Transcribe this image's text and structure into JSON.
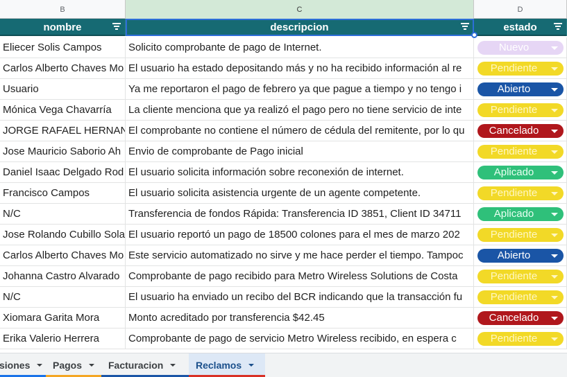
{
  "columns": [
    {
      "letter": "B",
      "header": "nombre",
      "selected": false
    },
    {
      "letter": "C",
      "header": "descripcion",
      "selected": true
    },
    {
      "letter": "D",
      "header": "estado",
      "selected": false
    }
  ],
  "status_colors": {
    "Nuevo": {
      "bg": "#e6d6f5",
      "fg": "#ffffff"
    },
    "Pendiente": {
      "bg": "#f2d927",
      "fg": "#fff7c2"
    },
    "Abierto": {
      "bg": "#1a55a6",
      "fg": "#ffffff"
    },
    "Cancelado": {
      "bg": "#b0171c",
      "fg": "#ffffff"
    },
    "Aplicado": {
      "bg": "#2fc07a",
      "fg": "#e9fff2"
    }
  },
  "rows": [
    {
      "nombre": "Eliecer Solis Campos",
      "descripcion": "Solicito comprobante de pago de Internet.",
      "estado": "Nuevo"
    },
    {
      "nombre": "Carlos Alberto Chaves Mo",
      "descripcion": "El usuario ha estado depositando más y no ha recibido información al re",
      "estado": "Pendiente"
    },
    {
      "nombre": "Usuario",
      "descripcion": "Ya me reportaron el pago de febrero ya que pague a tiempo y no tengo i",
      "estado": "Abierto"
    },
    {
      "nombre": "Mónica Vega Chavarría",
      "descripcion": "La cliente menciona que ya realizó el pago pero no tiene servicio de inte",
      "estado": "Pendiente"
    },
    {
      "nombre": "JORGE RAFAEL HERNAN",
      "descripcion": "El comprobante no contiene el número de cédula del remitente, por lo qu",
      "estado": "Cancelado"
    },
    {
      "nombre": "Jose Mauricio Saborio Ah",
      "descripcion": "Envio de comprobante de Pago inicial",
      "estado": "Pendiente"
    },
    {
      "nombre": "Daniel Isaac Delgado Rod",
      "descripcion": "El usuario solicita información sobre reconexión de internet.",
      "estado": "Aplicado"
    },
    {
      "nombre": "Francisco Campos",
      "descripcion": "El usuario solicita asistencia urgente de un agente competente.",
      "estado": "Pendiente"
    },
    {
      "nombre": "N/C",
      "descripcion": "Transferencia de fondos Rápida: Transferencia ID 3851, Client ID 34711",
      "estado": "Aplicado"
    },
    {
      "nombre": "Jose Rolando Cubillo Sola",
      "descripcion": "El usuario reportó un pago de 18500 colones para el mes de marzo 202",
      "estado": "Pendiente"
    },
    {
      "nombre": "Carlos Alberto Chaves Mo",
      "descripcion": "Este servicio automatizado no sirve y me hace perder el tiempo. Tampoc",
      "estado": "Abierto"
    },
    {
      "nombre": "Johanna Castro Alvarado",
      "descripcion": "Comprobante de pago recibido para Metro Wireless Solutions de Costa",
      "estado": "Pendiente"
    },
    {
      "nombre": "N/C",
      "descripcion": "El usuario ha enviado un recibo del BCR indicando que la transacción fu",
      "estado": "Pendiente"
    },
    {
      "nombre": "Xiomara Garita Mora",
      "descripcion": "Monto acreditado por transferencia $42.45",
      "estado": "Cancelado"
    },
    {
      "nombre": "Erika Valerio Herrera",
      "descripcion": "Comprobante de pago de servicio Metro Wireless recibido, en espera c",
      "estado": "Pendiente"
    }
  ],
  "tabs": [
    {
      "label": "siones",
      "active": false,
      "underline": "#1a73e8"
    },
    {
      "label": "Pagos",
      "active": false,
      "underline": "#f4a623"
    },
    {
      "label": "Facturacion",
      "active": false,
      "underline": "#1a55a6"
    },
    {
      "label": "Reclamos",
      "active": true,
      "underline": "#d93025"
    }
  ]
}
